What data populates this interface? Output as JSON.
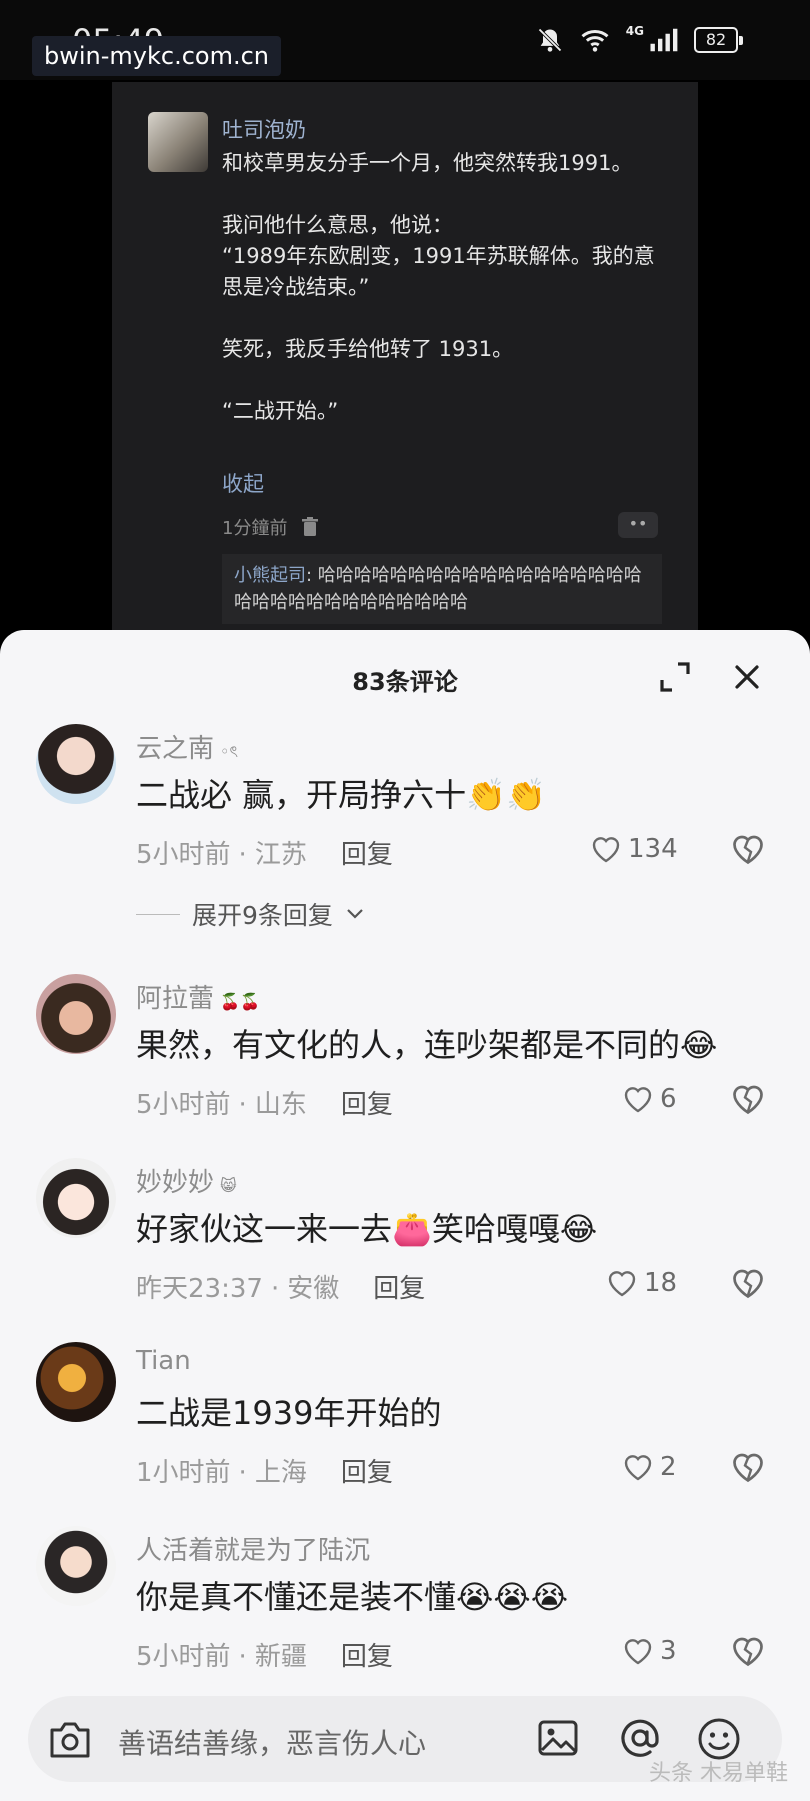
{
  "status_bar": {
    "time": "05:49",
    "watermark": "bwin-mykc.com.cn",
    "network": "4G",
    "battery": "82",
    "icons": [
      "mute-bell-icon",
      "wifi-icon",
      "signal-icon",
      "battery-icon"
    ]
  },
  "original_post": {
    "username": "吐司泡奶",
    "paragraphs": [
      "和校草男友分手一个月，他突然转我1991。",
      "",
      "我问他什么意思，他说：",
      "“1989年东欧剧变，1991年苏联解体。我的意思是冷战结束。”",
      "",
      "笑死，我反手给他转了 1931。",
      "",
      "“二战开始。”"
    ],
    "collapse_label": "收起",
    "time": "1分鐘前",
    "more": "••",
    "reply": {
      "username": "小熊起司",
      "text": ": 哈哈哈哈哈哈哈哈哈哈哈哈哈哈哈哈哈哈哈哈哈哈哈哈哈哈哈哈哈哈哈"
    }
  },
  "sheet": {
    "title": "83条评论",
    "comments": [
      {
        "name": "云之南",
        "badge": "◦ৎ",
        "text": "二战必 赢，开局挣六十👏👏",
        "time": "5小时前",
        "location": "江苏",
        "reply": "回复",
        "likes": "134",
        "expand": "展开9条回复"
      },
      {
        "name": "阿拉蕾",
        "badge": "🍒🍒",
        "text": "果然，有文化的人，连吵架都是不同的😂",
        "time": "5小时前",
        "location": "山东",
        "reply": "回复",
        "likes": "6"
      },
      {
        "name": "妙妙妙",
        "badge": "😸",
        "text": "好家伙这一来一去👛笑哈嘎嘎😂",
        "time": "昨天23:37",
        "location": "安徽",
        "reply": "回复",
        "likes": "18"
      },
      {
        "name": "Tian",
        "badge": "",
        "text": "二战是1939年开始的",
        "time": "1小时前",
        "location": "上海",
        "reply": "回复",
        "likes": "2"
      },
      {
        "name": "人活着就是为了陆沉",
        "badge": "",
        "text": "你是真不懂还是装不懂😭😭😭",
        "time": "5小时前",
        "location": "新疆",
        "reply": "回复",
        "likes": "3"
      }
    ]
  },
  "input_bar": {
    "placeholder": "善语结善缘，恶言伤人心"
  },
  "corner_watermark": "头条 木易单鞋",
  "colors": {
    "sheet_bg": "#f6f6f8",
    "dark_card": "#1d1d1f",
    "link_blue": "#9fb3d0"
  }
}
